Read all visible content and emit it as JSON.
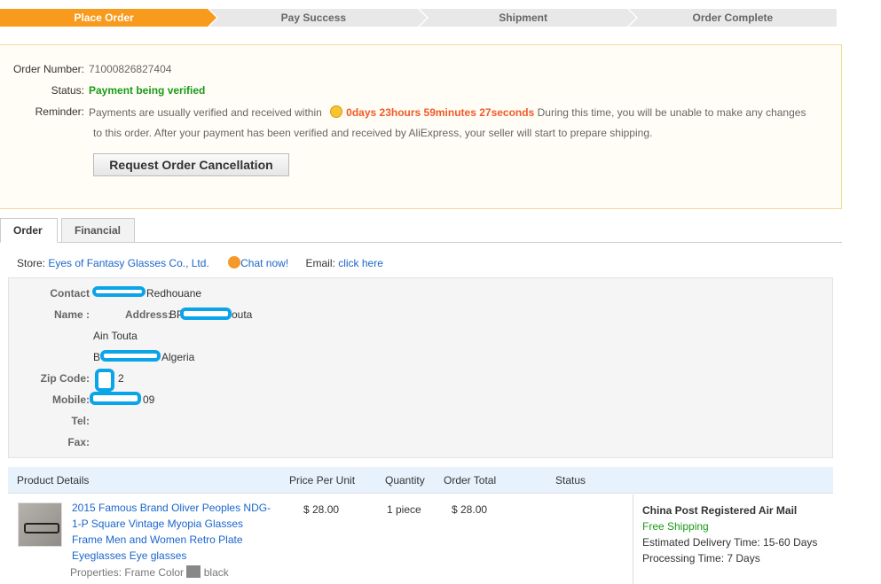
{
  "steps": [
    "Place Order",
    "Pay Success",
    "Shipment",
    "Order Complete"
  ],
  "order": {
    "number_label": "Order Number:",
    "number": "71000826827404",
    "status_label": "Status:",
    "status": "Payment being verified",
    "reminder_label": "Reminder:",
    "reminder_pre": "Payments are usually verified and received within",
    "countdown": "0days 23hours 59minutes 27seconds",
    "reminder_post": "During this time, you will be unable to make any changes",
    "reminder_line2": "to this order. After your payment has been verified and received by AliExpress, your seller will start to prepare shipping.",
    "cancel_button": "Request Order Cancellation"
  },
  "tabs": [
    "Order",
    "Financial"
  ],
  "store": {
    "label": "Store:",
    "name": "Eyes of Fantasy Glasses Co., Ltd.",
    "chat": "Chat now!",
    "email_label": "Email:",
    "email_link": "click here"
  },
  "address": {
    "contact_label": "Contact",
    "contact_value": "Redhouane",
    "name_label": "Name :",
    "address_label": "Address:",
    "address_line1_a": "BP",
    "address_line1_b": "outa",
    "address_line2": "Ain Touta",
    "address_line3_a": "B",
    "address_line3_b": "Algeria",
    "zip_label": "Zip Code:",
    "zip_value": "2",
    "mobile_label": "Mobile:",
    "mobile_value": "09",
    "tel_label": "Tel:",
    "fax_label": "Fax:"
  },
  "table": {
    "headers": [
      "Product Details",
      "Price Per Unit",
      "Quantity",
      "Order Total",
      "Status"
    ],
    "product": {
      "title": "2015 Famous Brand Oliver Peoples NDG-1-P Square Vintage Myopia Glasses Frame Men and Women Retro Plate Eyeglasses Eye glasses",
      "properties": "Properties: Frame Color",
      "color": "black",
      "price": "$ 28.00",
      "quantity": "1 piece",
      "total": "$ 28.00"
    },
    "shipping": {
      "method": "China Post Registered Air Mail",
      "cost": "Free Shipping",
      "delivery": "Estimated Delivery Time:  15-60 Days",
      "processing": "Processing Time:  7 Days"
    }
  },
  "colors": {
    "accent": "#f89a1c",
    "status_green": "#1a9a1a",
    "countdown": "#f05a28",
    "link": "#1a66cc"
  }
}
